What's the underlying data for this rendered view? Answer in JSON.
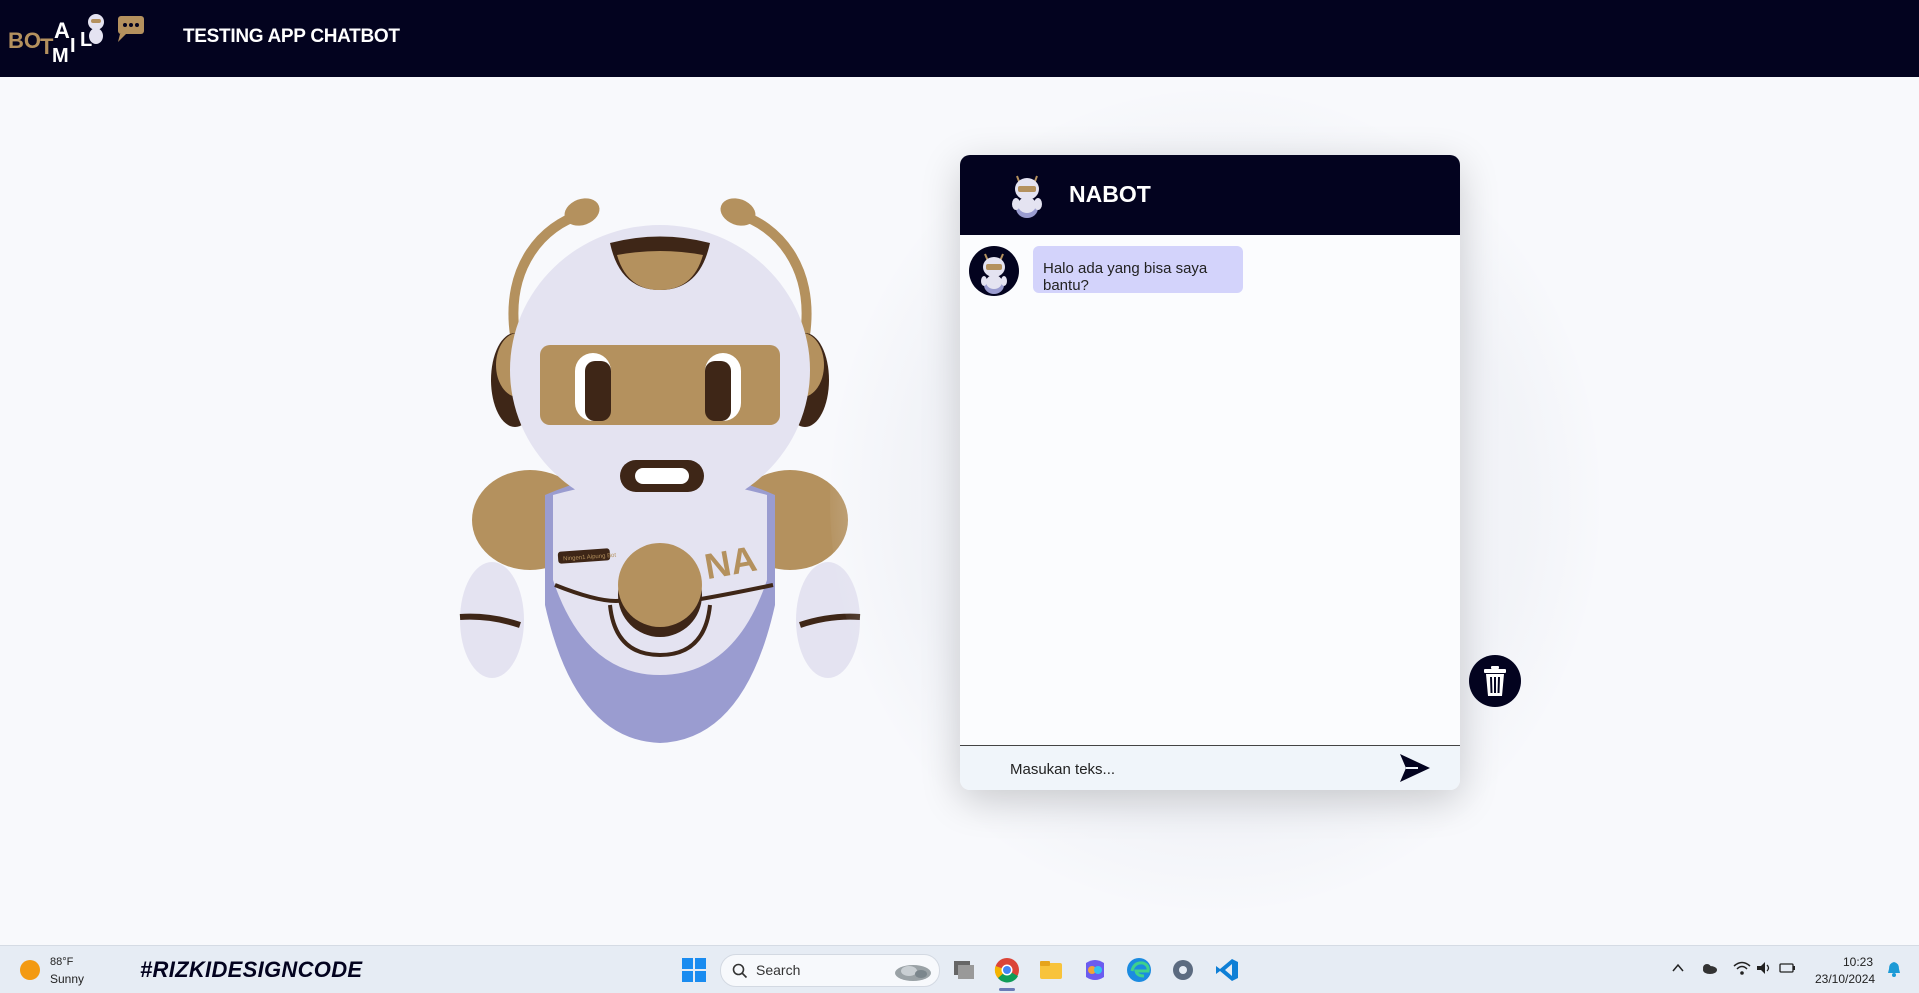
{
  "header": {
    "app_title": "TESTING APP CHATBOT",
    "logo_text": "BOT AIML"
  },
  "chat": {
    "title": "NABOT",
    "messages": [
      {
        "sender": "bot",
        "text": "Halo ada yang bisa saya bantu?"
      }
    ],
    "input": {
      "placeholder": "Masukan teks...",
      "value": ""
    }
  },
  "mascot": {
    "chest_text": "NA",
    "badge_text": "Ningen1 Aipung Bot"
  },
  "taskbar": {
    "weather_temp": "88°F",
    "weather_desc": "Sunny",
    "hashtag": "#RIZKIDESIGNCODE",
    "search_label": "Search",
    "time": "10:23",
    "date": "23/10/2024"
  },
  "colors": {
    "navy": "#03031f",
    "gold": "#b4915e",
    "lavender": "#9a9cd0",
    "bubble": "#d3d3fb"
  }
}
